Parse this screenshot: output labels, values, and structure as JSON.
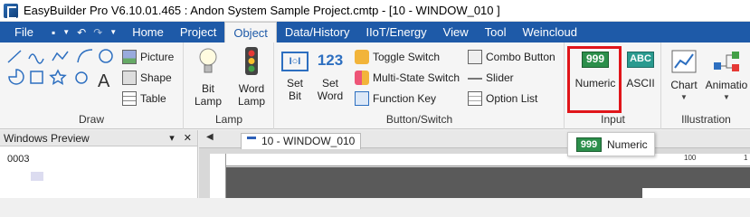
{
  "titlebar": {
    "text": "EasyBuilder Pro V6.10.01.465 : Andon System Sample Project.cmtp - [10 - WINDOW_010 ]"
  },
  "menubar": {
    "file": "File",
    "tabs": [
      "Home",
      "Project",
      "Object",
      "Data/History",
      "IIoT/Energy",
      "View",
      "Tool",
      "Weincloud"
    ],
    "active": "Object"
  },
  "ribbon": {
    "draw": {
      "picture": "Picture",
      "shape": "Shape",
      "table": "Table",
      "label": "Draw"
    },
    "lamp": {
      "bit_lamp": [
        "Bit",
        "Lamp"
      ],
      "word_lamp": [
        "Word",
        "Lamp"
      ],
      "label": "Lamp"
    },
    "button_switch": {
      "set_bit": [
        "Set",
        "Bit"
      ],
      "set_word": [
        "Set",
        "Word"
      ],
      "set_bit_icon": "I○I",
      "set_word_icon": "123",
      "toggle_switch": "Toggle Switch",
      "multi_state_switch": "Multi-State Switch",
      "function_key": "Function Key",
      "combo_button": "Combo Button",
      "slider": "Slider",
      "option_list": "Option List",
      "label": "Button/Switch"
    },
    "input": {
      "numeric": "Numeric",
      "numeric_icon": "999",
      "ascii": "ASCII",
      "ascii_icon": "ABC",
      "label": "Input"
    },
    "illustration": {
      "chart": "Chart",
      "animation": "Animatio",
      "label": "Illustration"
    }
  },
  "windows_preview": {
    "title": "Windows Preview",
    "pin": "▾",
    "close": "✕",
    "item": "0003"
  },
  "editor": {
    "tab": "10 - WINDOW_010",
    "ruler_mark": "100",
    "ruler_mark_2": "1"
  },
  "tooltip": {
    "icon": "999",
    "text": "Numeric"
  },
  "colors": {
    "menubar_bg": "#1e5aa8",
    "highlight": "#e0151a"
  }
}
